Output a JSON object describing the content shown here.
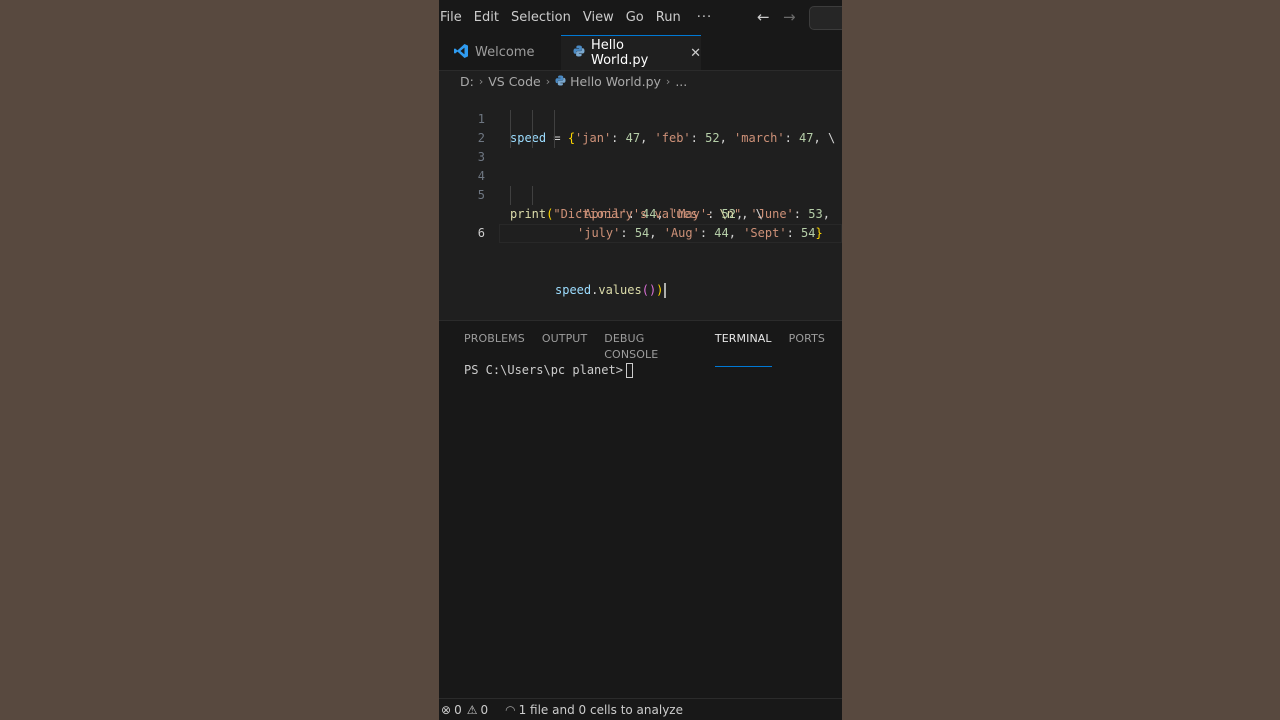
{
  "menu": {
    "items": [
      "File",
      "Edit",
      "Selection",
      "View",
      "Go",
      "Run"
    ],
    "more": "···"
  },
  "tabs": [
    {
      "label": "Welcome",
      "icon": "vscode-icon",
      "active": false
    },
    {
      "label": "Hello World.py",
      "icon": "python-icon",
      "active": true
    }
  ],
  "breadcrumb": {
    "drive": "D:",
    "folder": "VS Code",
    "file": "Hello World.py",
    "ellipsis": "..."
  },
  "editor": {
    "current_line": 6,
    "lines": [
      {
        "num": "1",
        "text": "speed = {'jan': 47, 'feb': 52, 'march': 47, \\"
      },
      {
        "num": "2",
        "text": "'April': 44, 'May': 52, 'June': 53,"
      },
      {
        "num": "3",
        "text": "'july': 54, 'Aug': 44, 'Sept': 54}"
      },
      {
        "num": "4",
        "text": ""
      },
      {
        "num": "5",
        "text": "print(\"Dictionary's values - \\n\", \\"
      },
      {
        "num": "6",
        "text": "speed.values()"
      }
    ]
  },
  "panel": {
    "tabs": [
      "PROBLEMS",
      "OUTPUT",
      "DEBUG CONSOLE",
      "TERMINAL",
      "PORTS"
    ],
    "active_tab": "TERMINAL",
    "terminal_prompt": "PS C:\\Users\\pc planet>"
  },
  "status": {
    "errors": "0",
    "warnings": "0",
    "analysis": "1 file and 0 cells to analyze"
  },
  "colors": {
    "accent": "#0078d4",
    "editor_bg": "#1f1f1f",
    "chrome_bg": "#181818",
    "backdrop": "#574a41"
  }
}
